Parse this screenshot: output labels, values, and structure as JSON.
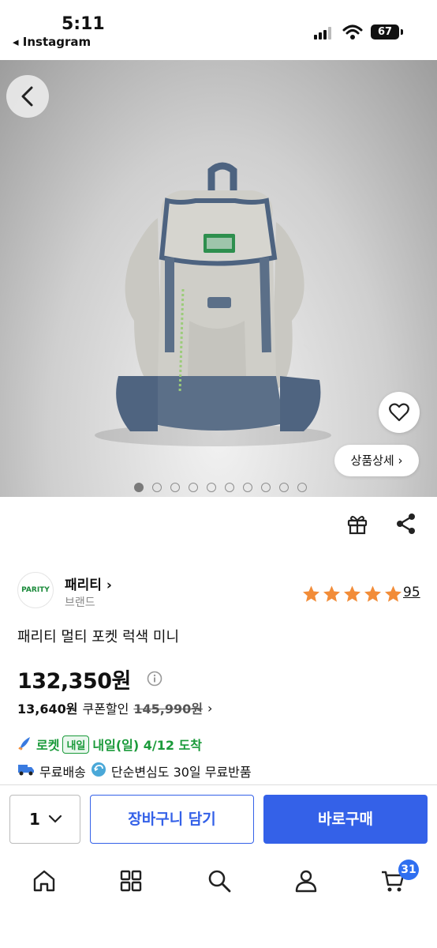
{
  "status": {
    "time": "5:11",
    "back_app": "◂ Instagram",
    "battery": "67"
  },
  "hero": {
    "detail_label": "상품상세 ›",
    "dots_total": 10,
    "dots_active": 1
  },
  "brand": {
    "logo_text": "PARITY",
    "name": "패리티 ›",
    "sub": "브랜드"
  },
  "rating": {
    "stars": 5,
    "count": "95",
    "color": "#f28c38"
  },
  "product": {
    "title": "패리티 멀티 포켓 럭색 미니",
    "price": "132,350원",
    "coupon_price": "13,640원",
    "coupon_label": "쿠폰할인",
    "original_price": "145,990원",
    "coupon_arrow": "›"
  },
  "delivery": {
    "rocket_label": "로켓",
    "badge": "내일",
    "eta": "내일(일) 4/12 도착",
    "free_shipping": "무료배송",
    "return_policy": "단순변심도 30일 무료반품"
  },
  "purchase": {
    "quantity": "1",
    "cart_label": "장바구니 담기",
    "buy_label": "바로구매",
    "accent": "#3461e8"
  },
  "tabbar": {
    "cart_count": "31"
  }
}
